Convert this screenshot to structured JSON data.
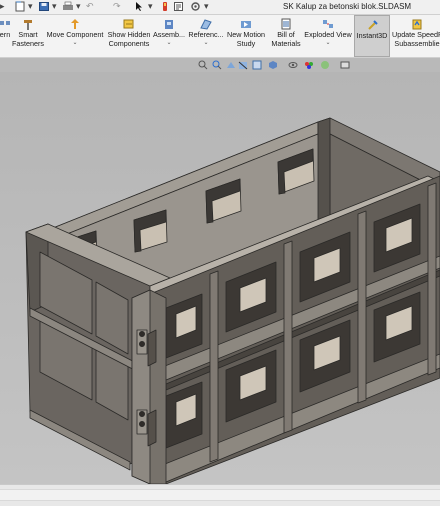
{
  "window": {
    "title": "SK Kalup za betonski blok.SLDASM"
  },
  "ribbon": {
    "buttons": [
      {
        "label": "ern",
        "icon": "pattern-icon"
      },
      {
        "label": "Smart\nFasteners",
        "icon": "smart-fasteners-icon"
      },
      {
        "label": "Move Component",
        "icon": "move-component-icon"
      },
      {
        "label": "Show Hidden\nComponents",
        "icon": "show-hidden-icon"
      },
      {
        "label": "Assemb...",
        "icon": "assembly-features-icon"
      },
      {
        "label": "Referenc...",
        "icon": "reference-geometry-icon"
      },
      {
        "label": "New Motion\nStudy",
        "icon": "motion-study-icon"
      },
      {
        "label": "Bill of\nMaterials",
        "icon": "bom-icon"
      },
      {
        "label": "Exploded View",
        "icon": "exploded-view-icon"
      },
      {
        "label": "Instant3D",
        "icon": "instant3d-icon",
        "active": true
      },
      {
        "label": "Update SpeedP\nSubassemblie",
        "icon": "speedpak-icon"
      }
    ]
  },
  "colors": {
    "background": "#b9b9b9",
    "model": "#5e5b57",
    "accent": "#1f6fd1"
  }
}
